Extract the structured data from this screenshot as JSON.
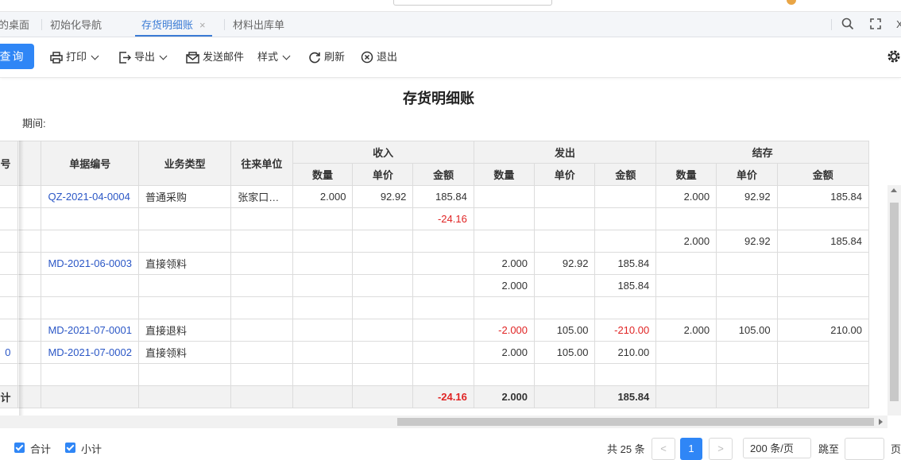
{
  "tabs": [
    {
      "label": "的桌面",
      "active": false
    },
    {
      "label": "初始化导航",
      "active": false
    },
    {
      "label": "存货明细账",
      "active": true,
      "close": "×"
    },
    {
      "label": "材料出库单",
      "active": false
    }
  ],
  "tab_tools": {
    "close_glyph": "X"
  },
  "toolbar": {
    "query": "查询",
    "print": "打印",
    "export": "导出",
    "send_mail": "发送邮件",
    "style": "样式",
    "refresh": "刷新",
    "exit": "退出"
  },
  "report": {
    "title": "存货明细账",
    "period_label": "期间:"
  },
  "table": {
    "frozen_header": "号",
    "headers": {
      "doc_no": "单据编号",
      "biz_type": "业务类型",
      "partner": "往来单位",
      "receipt": "收入",
      "issue": "发出",
      "balance": "结存",
      "qty": "数量",
      "price": "单价",
      "amount": "金额"
    },
    "rows": [
      {
        "first": "",
        "doc": "QZ-2021-04-0004",
        "type": "普通采购",
        "partner": "张家口…",
        "rq": "2.000",
        "rp": "92.92",
        "ra": "185.84",
        "iq": "",
        "ip": "",
        "ia": "",
        "bq": "2.000",
        "bp": "92.92",
        "ba": "185.84"
      },
      {
        "first": "",
        "doc": "",
        "type": "",
        "partner": "",
        "rq": "",
        "rp": "",
        "ra": "-24.16",
        "iq": "",
        "ip": "",
        "ia": "",
        "bq": "",
        "bp": "",
        "ba": ""
      },
      {
        "first": "",
        "doc": "",
        "type": "",
        "partner": "",
        "rq": "",
        "rp": "",
        "ra": "",
        "iq": "",
        "ip": "",
        "ia": "",
        "bq": "2.000",
        "bp": "92.92",
        "ba": "185.84"
      },
      {
        "first": "",
        "doc": "MD-2021-06-0003",
        "type": "直接领料",
        "partner": "",
        "rq": "",
        "rp": "",
        "ra": "",
        "iq": "2.000",
        "ip": "92.92",
        "ia": "185.84",
        "bq": "",
        "bp": "",
        "ba": ""
      },
      {
        "first": "",
        "doc": "",
        "type": "",
        "partner": "",
        "rq": "",
        "rp": "",
        "ra": "",
        "iq": "2.000",
        "ip": "",
        "ia": "185.84",
        "bq": "",
        "bp": "",
        "ba": ""
      },
      {
        "first": "",
        "doc": "",
        "type": "",
        "partner": "",
        "rq": "",
        "rp": "",
        "ra": "",
        "iq": "",
        "ip": "",
        "ia": "",
        "bq": "",
        "bp": "",
        "ba": ""
      },
      {
        "first": "",
        "doc": "MD-2021-07-0001",
        "type": "直接退料",
        "partner": "",
        "rq": "",
        "rp": "",
        "ra": "",
        "iq": "-2.000",
        "ip": "105.00",
        "ia": "-210.00",
        "bq": "2.000",
        "bp": "105.00",
        "ba": "210.00"
      },
      {
        "first": "0",
        "doc": "MD-2021-07-0002",
        "type": "直接领料",
        "partner": "",
        "rq": "",
        "rp": "",
        "ra": "",
        "iq": "2.000",
        "ip": "105.00",
        "ia": "210.00",
        "bq": "",
        "bp": "",
        "ba": ""
      },
      {
        "first": "",
        "doc": "",
        "type": "",
        "partner": "",
        "rq": "",
        "rp": "",
        "ra": "",
        "iq": "",
        "ip": "",
        "ia": "",
        "bq": "",
        "bp": "",
        "ba": ""
      }
    ],
    "total": {
      "first": "计",
      "rq": "",
      "rp": "",
      "ra": "-24.16",
      "iq": "2.000",
      "ip": "",
      "ia": "185.84",
      "bq": "",
      "bp": "",
      "ba": ""
    }
  },
  "footer": {
    "total_label": "合计",
    "subtotal_label": "小计",
    "count_text": "共 25 条",
    "prev": "<",
    "page": "1",
    "next": ">",
    "page_size": "200 条/页",
    "jump_label": "跳至",
    "page_suffix": "页"
  },
  "colors": {
    "accent": "#2f86f6",
    "negative": "#e02424",
    "link": "#2b57c6"
  }
}
